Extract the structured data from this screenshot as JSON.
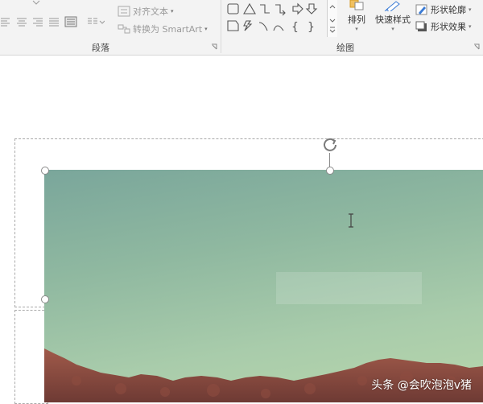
{
  "ribbon": {
    "paragraph": {
      "label": "段落",
      "align_text": "对齐文本",
      "convert_smartart": "转换为 SmartArt"
    },
    "drawing": {
      "label": "绘图",
      "arrange": "排列",
      "quick_styles": "快速样式",
      "shape_outline": "形状轮廓",
      "shape_effects": "形状效果"
    }
  },
  "watermark": {
    "text": "头条 @会吹泡泡v猪"
  }
}
